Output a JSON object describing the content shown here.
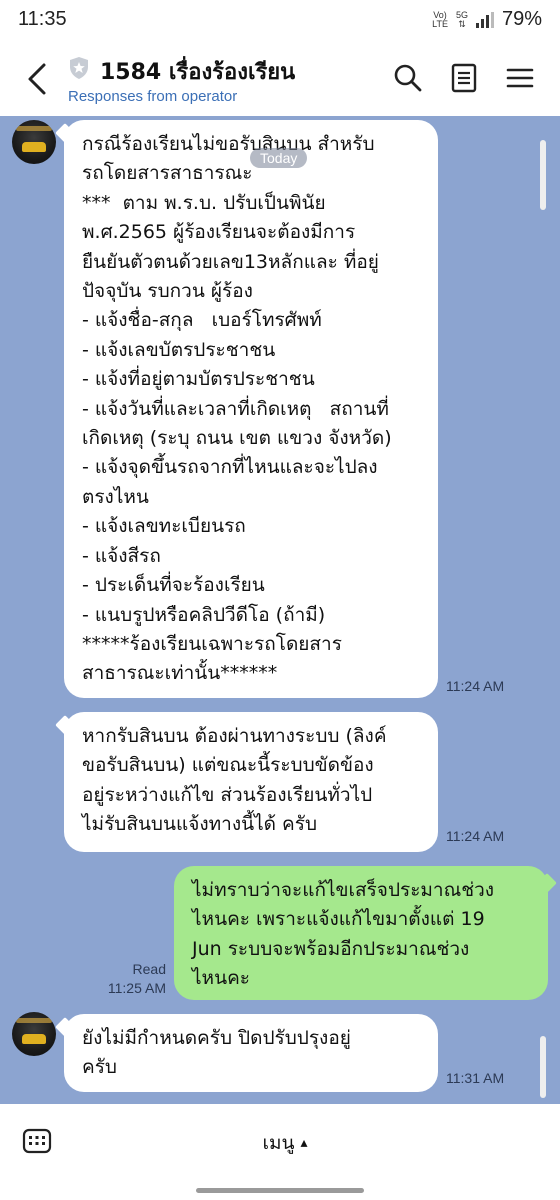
{
  "status_bar": {
    "time": "11:35",
    "network_top": "Vo)",
    "network_bottom": "LTE",
    "signal_label_top": "5G",
    "signal_label_bottom": "⇅",
    "battery": "79%"
  },
  "header": {
    "title": "1584 เรื่องร้องเรียน",
    "subtitle": "Responses from operator"
  },
  "chat": {
    "today_label": "Today",
    "messages": [
      {
        "sender": "operator",
        "text": "กรณีร้องเรียนไม่ขอรับสินบน สำหรับ\nรถโดยสารสาธารณะ\n***  ตาม พ.ร.บ. ปรับเป็นพินัย\nพ.ศ.2565 ผู้ร้องเรียนจะต้องมีการ\nยืนยันตัวตนด้วยเลข13หลักและ ที่อยู่\nปัจจุบัน รบกวน ผู้ร้อง\n- แจ้งชื่อ-สกุล   เบอร์โทรศัพท์\n- แจ้งเลขบัตรประชาชน\n- แจ้งที่อยู่ตามบัตรประชาชน\n- แจ้งวันที่และเวลาที่เกิดเหตุ   สถานที่\nเกิดเหตุ (ระบุ ถนน เขต แขวง จังหวัด)\n- แจ้งจุดขึ้นรถจากที่ไหนและจะไปลง\nตรงไหน\n- แจ้งเลขทะเบียนรถ\n- แจ้งสีรถ\n- ประเด็นที่จะร้องเรียน\n- แนบรูปหรือคลิปวีดีโอ (ถ้ามี)\n*****ร้องเรียนเฉพาะรถโดยสาร\nสาธารณะเท่านั้น******",
        "time": "11:24 AM"
      },
      {
        "sender": "operator",
        "text": "หากรับสินบน ต้องผ่านทางระบบ (ลิงค์\nขอรับสินบน) แต่ขณะนี้ระบบขัดข้อง\nอยู่ระหว่างแก้ไข ส่วนร้องเรียนทั่วไป\nไม่รับสินบนแจ้งทางนี้ได้ ครับ",
        "time": "11:24 AM"
      },
      {
        "sender": "me",
        "text": "ไม่ทราบว่าจะแก้ไขเสร็จประมาณช่วง\nไหนคะ เพราะแจ้งแก้ไขมาตั้งแต่ 19\nJun ระบบจะพร้อมอีกประมาณช่วง\nไหนคะ",
        "read_label": "Read",
        "time": "11:25 AM"
      },
      {
        "sender": "operator",
        "text": "ยังไม่มีกำหนดครับ ปิดปรับปรุงอยู่\nครับ",
        "time": "11:31 AM"
      }
    ]
  },
  "bottom_bar": {
    "menu_label": "เมนู",
    "menu_caret": "▴"
  },
  "colors": {
    "chat_background": "#8ca4d0",
    "incoming_bubble": "#ffffff",
    "outgoing_bubble": "#a5e88d",
    "subtitle_link": "#3b6fb6"
  }
}
